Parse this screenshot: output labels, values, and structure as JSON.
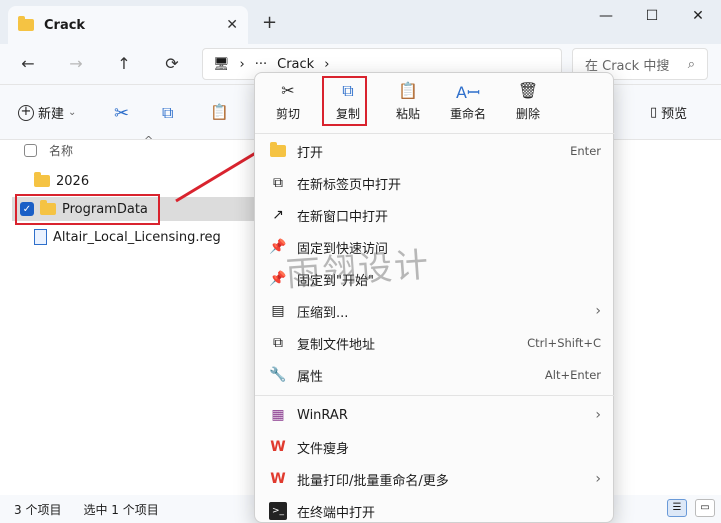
{
  "window": {
    "tab_title": "Crack",
    "close_tab": "✕",
    "new_tab": "+",
    "minimize": "—",
    "maximize": "☐",
    "close": "✕"
  },
  "nav": {
    "back": "←",
    "forward": "→",
    "up": "↑",
    "refresh": "⟳",
    "pc_icon": "🖥",
    "sep1": "›",
    "more": "···",
    "folder": "Crack",
    "sep2": "›",
    "search_placeholder": "在 Crack 中搜",
    "search_icon": "⌕"
  },
  "toolbar": {
    "new_label": "新建",
    "new_arrow": "⌄",
    "cut": "✂",
    "copy": "⧉",
    "paste": "📋",
    "preview_label": "预览",
    "preview_icon": "▯"
  },
  "list": {
    "header": "名称",
    "sort_arrow": "^",
    "items": [
      {
        "name": "2026"
      },
      {
        "name": "ProgramData"
      },
      {
        "name": "Altair_Local_Licensing.reg"
      }
    ]
  },
  "status": {
    "count": "3 个项目",
    "selected": "选中 1 个项目"
  },
  "context_menu": {
    "quick": [
      {
        "label": "剪切",
        "icon": "✂"
      },
      {
        "label": "复制",
        "icon": "⧉"
      },
      {
        "label": "粘贴",
        "icon": "📋"
      },
      {
        "label": "重命名",
        "icon": "Aꟷ"
      },
      {
        "label": "删除",
        "icon": "🗑"
      }
    ],
    "items": [
      {
        "label": "打开",
        "shortcut": "Enter",
        "icon": "▬",
        "color": "#f5c343"
      },
      {
        "label": "在新标签页中打开",
        "shortcut": "",
        "icon": "⧉",
        "color": "#333333"
      },
      {
        "label": "在新窗口中打开",
        "shortcut": "",
        "icon": "↗",
        "color": "#333333"
      },
      {
        "label": "固定到快速访问",
        "shortcut": "",
        "icon": "📌",
        "color": "#2e6fcb"
      },
      {
        "label": "固定到\"开始\"",
        "shortcut": "",
        "icon": "📌",
        "color": "#2e6fcb"
      },
      {
        "label": "压缩到...",
        "shortcut": "›",
        "icon": "▤",
        "color": "#333333"
      },
      {
        "label": "复制文件地址",
        "shortcut": "Ctrl+Shift+C",
        "icon": "⧉",
        "color": "#333333"
      },
      {
        "label": "属性",
        "shortcut": "Alt+Enter",
        "icon": "🔧",
        "color": "#333333"
      },
      {
        "label": "WinRAR",
        "shortcut": "›",
        "icon": "▦",
        "color": "#8a3b8f"
      },
      {
        "label": "文件瘦身",
        "shortcut": "",
        "icon": "W",
        "color": "#e03a2e"
      },
      {
        "label": "批量打印/批量重命名/更多",
        "shortcut": "›",
        "icon": "W",
        "color": "#e03a2e"
      },
      {
        "label": "在终端中打开",
        "shortcut": "",
        "icon": ">_",
        "color": "#333333"
      }
    ]
  },
  "watermark": "雨翎设计",
  "colors": {
    "highlight_red": "#d9232e",
    "accent_blue": "#1a5fc6",
    "folder_yellow": "#f5c343"
  }
}
